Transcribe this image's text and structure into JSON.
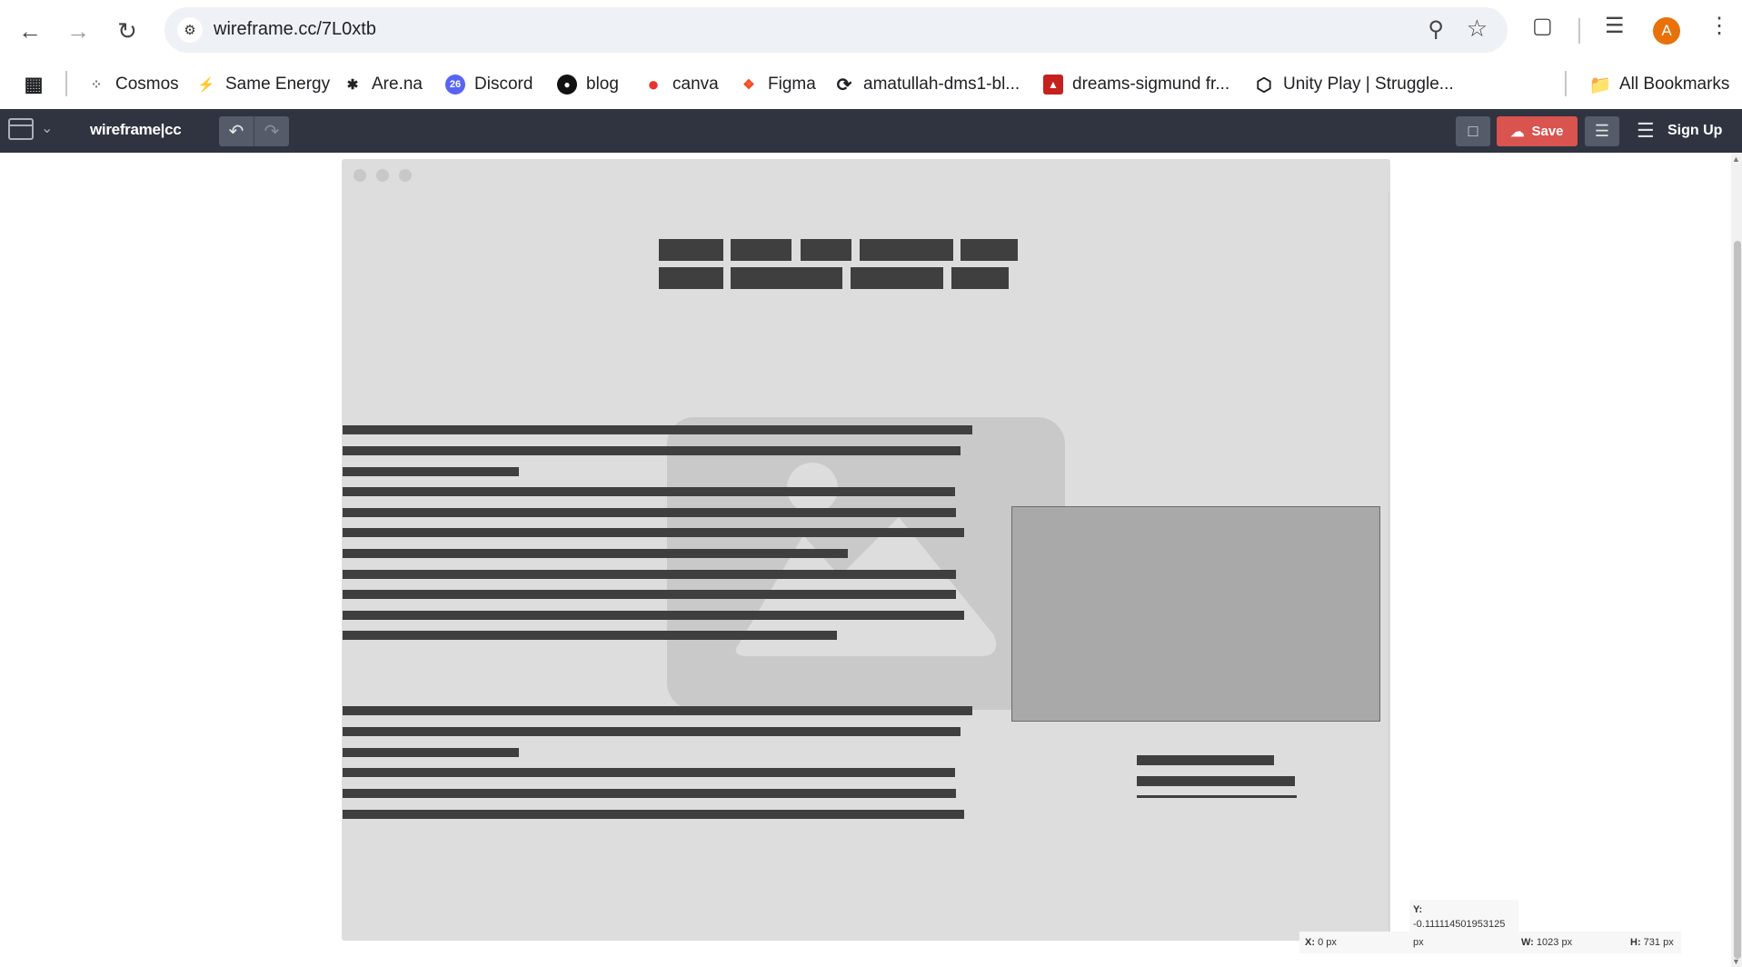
{
  "browser": {
    "url": "wireframe.cc/7L0xtb",
    "avatar_letter": "A",
    "bookmarks": [
      {
        "label": "Cosmos",
        "icon": "cosmos-icon"
      },
      {
        "label": "Same Energy",
        "icon": "same-energy-icon"
      },
      {
        "label": "Are.na",
        "icon": "arena-icon"
      },
      {
        "label": "Discord",
        "icon": "discord-icon"
      },
      {
        "label": "blog",
        "icon": "github-icon"
      },
      {
        "label": "canva",
        "icon": "canva-icon"
      },
      {
        "label": "Figma",
        "icon": "figma-icon"
      },
      {
        "label": "amatullah-dms1-bl...",
        "icon": "github-icon"
      },
      {
        "label": "dreams-sigmund fr...",
        "icon": "pdf-icon"
      },
      {
        "label": "Unity Play | Struggle...",
        "icon": "unity-icon"
      }
    ],
    "all_bookmarks_label": "All Bookmarks"
  },
  "toolbar": {
    "brand": "wireframe|cc",
    "save_label": "Save",
    "signup_label": "Sign Up"
  },
  "readout": {
    "x_label": "X:",
    "x_value": "0 px",
    "y_label": "Y:",
    "y_value": "-0.111114501953125",
    "y_unit": "px",
    "w_label": "W:",
    "w_value": "1023 px",
    "h_label": "H:",
    "h_value": "731 px"
  },
  "colors": {
    "toolbar_bg": "#2f3440",
    "save_button": "#d9534f",
    "wireframe_bg": "#dddddd",
    "wireframe_block": "#3f3f3f",
    "avatar": "#e8710a"
  }
}
